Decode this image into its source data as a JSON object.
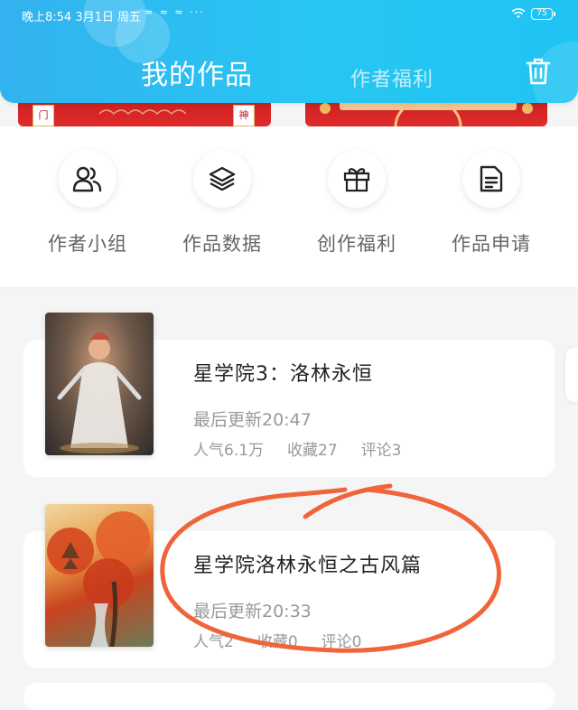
{
  "status_bar": {
    "time_date": "晚上8:54  3月1日 周五",
    "notification_icons": "≈ ≈ ≈  ···",
    "battery": "75"
  },
  "header": {
    "tab_mine": "我的作品",
    "tab_benefits": "作者福利",
    "trash_icon": "trash-icon"
  },
  "banner": {
    "left_chars": [
      "门",
      "神"
    ]
  },
  "actions": [
    {
      "label": "作者小组",
      "icon": "users-icon"
    },
    {
      "label": "作品数据",
      "icon": "layers-icon"
    },
    {
      "label": "创作福利",
      "icon": "gift-icon"
    },
    {
      "label": "作品申请",
      "icon": "document-icon"
    }
  ],
  "works": [
    {
      "title": "星学院3：洛林永恒",
      "updated": "最后更新20:47",
      "popularity": "人气6.1万",
      "favorites": "收藏27",
      "comments": "评论3"
    },
    {
      "title": "星学院洛林永恒之古风篇",
      "updated": "最后更新20:33",
      "popularity": "人气2",
      "favorites": "收藏0",
      "comments": "评论0"
    }
  ],
  "colors": {
    "header_start": "#32b2f0",
    "header_end": "#1fc3f3",
    "annotation": "#f0643a",
    "banner_red": "#c11a1e"
  }
}
